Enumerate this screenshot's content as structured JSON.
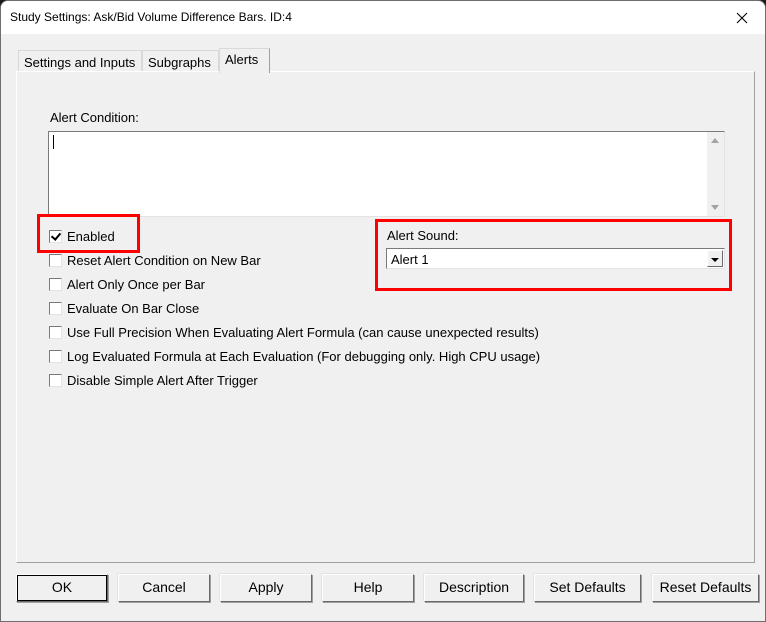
{
  "window": {
    "title": "Study Settings: Ask/Bid Volume Difference Bars. ID:4"
  },
  "tabs": [
    {
      "label": "Settings and Inputs",
      "active": false
    },
    {
      "label": "Subgraphs",
      "active": false
    },
    {
      "label": "Alerts",
      "active": true
    }
  ],
  "alerts": {
    "condition_label": "Alert Condition:",
    "condition_value": "",
    "checkboxes": [
      {
        "label": "Enabled",
        "checked": true
      },
      {
        "label": "Reset Alert Condition on New Bar",
        "checked": false
      },
      {
        "label": "Alert Only Once per Bar",
        "checked": false
      },
      {
        "label": "Evaluate On Bar Close",
        "checked": false
      },
      {
        "label": "Use Full Precision When Evaluating Alert Formula (can cause unexpected results)",
        "checked": false
      },
      {
        "label": "Log Evaluated Formula at Each Evaluation (For debugging only. High CPU usage)",
        "checked": false
      },
      {
        "label": "Disable Simple Alert After Trigger",
        "checked": false
      }
    ],
    "sound_label": "Alert Sound:",
    "sound_value": "Alert 1"
  },
  "buttons": {
    "ok": "OK",
    "cancel": "Cancel",
    "apply": "Apply",
    "help": "Help",
    "description": "Description",
    "set_defaults": "Set Defaults",
    "reset_defaults": "Reset Defaults"
  },
  "annotations": {
    "highlight_color": "#ff0000"
  }
}
